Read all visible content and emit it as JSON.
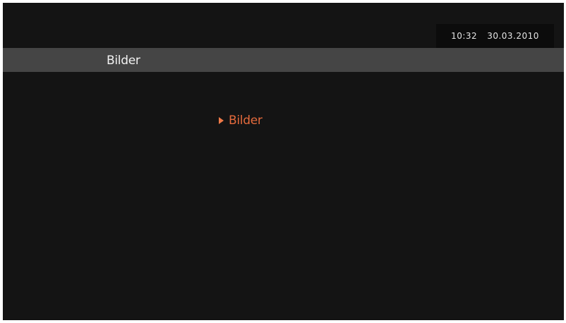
{
  "status": {
    "time": "10:32",
    "date": "30.03.2010"
  },
  "header": {
    "title": "Bilder"
  },
  "menu": {
    "items": [
      {
        "label": "Bilder",
        "selected": true,
        "icon": "play-arrow-icon"
      }
    ]
  },
  "colors": {
    "background": "#141414",
    "title_bar": "#454545",
    "selected_item": "#e46a3c"
  }
}
